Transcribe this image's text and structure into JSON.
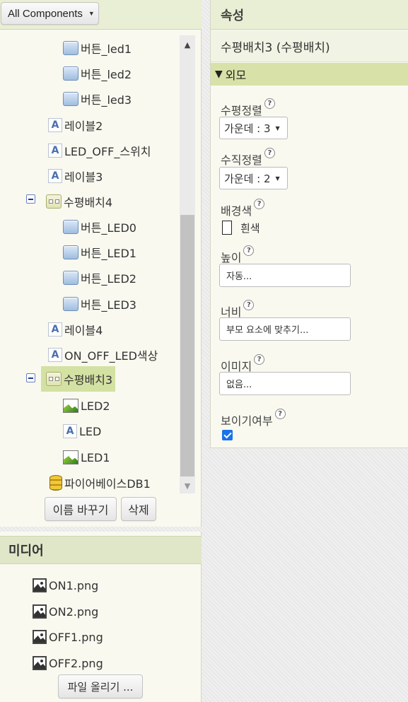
{
  "components": {
    "filter_label": "All Components",
    "tree": [
      {
        "id": "btn-led1",
        "label": "버튼_led1",
        "icon": "button-icon"
      },
      {
        "id": "btn-led2",
        "label": "버튼_led2",
        "icon": "button-icon"
      },
      {
        "id": "btn-led3",
        "label": "버튼_led3",
        "icon": "button-icon"
      },
      {
        "id": "label2",
        "label": "레이블2",
        "icon": "label-icon"
      },
      {
        "id": "led-off-switch",
        "label": "LED_OFF_스위치",
        "icon": "label-icon"
      },
      {
        "id": "label3",
        "label": "레이블3",
        "icon": "label-icon"
      },
      {
        "id": "hlayout4",
        "label": "수평배치4",
        "icon": "horizontal-arrangement-icon"
      },
      {
        "id": "btn-LED0",
        "label": "버튼_LED0",
        "icon": "button-icon"
      },
      {
        "id": "btn-LED1",
        "label": "버튼_LED1",
        "icon": "button-icon"
      },
      {
        "id": "btn-LED2",
        "label": "버튼_LED2",
        "icon": "button-icon"
      },
      {
        "id": "btn-LED3",
        "label": "버튼_LED3",
        "icon": "button-icon"
      },
      {
        "id": "label4",
        "label": "레이블4",
        "icon": "label-icon"
      },
      {
        "id": "on-off-led-color",
        "label": "ON_OFF_LED색상",
        "icon": "label-icon"
      },
      {
        "id": "hlayout3",
        "label": "수평배치3",
        "icon": "horizontal-arrangement-icon"
      },
      {
        "id": "img-led2",
        "label": "LED2",
        "icon": "image-icon"
      },
      {
        "id": "lbl-led",
        "label": "LED",
        "icon": "label-icon"
      },
      {
        "id": "img-led1",
        "label": "LED1",
        "icon": "image-icon"
      },
      {
        "id": "firebase-db1",
        "label": "파이어베이스DB1",
        "icon": "database-icon"
      }
    ],
    "rename_button": "이름 바꾸기",
    "delete_button": "삭제"
  },
  "media": {
    "title": "미디어",
    "files": [
      "ON1.png",
      "ON2.png",
      "OFF1.png",
      "OFF2.png"
    ],
    "upload_button": "파일 올리기 ..."
  },
  "properties": {
    "title": "속성",
    "component_name": "수평배치3 (수평배치)",
    "section": "외모",
    "align_horizontal_label": "수평정렬",
    "align_horizontal_value": "가운데 : 3",
    "align_vertical_label": "수직정렬",
    "align_vertical_value": "가운데 : 2",
    "bg_color_label": "배경색",
    "bg_color_value": "흰색",
    "height_label": "높이",
    "height_value": "자동...",
    "width_label": "너비",
    "width_value": "부모 요소에 맞추기...",
    "image_label": "이미지",
    "image_value": "없음...",
    "visible_label": "보이기여부",
    "visible_checked": true,
    "help_glyph": "?"
  }
}
